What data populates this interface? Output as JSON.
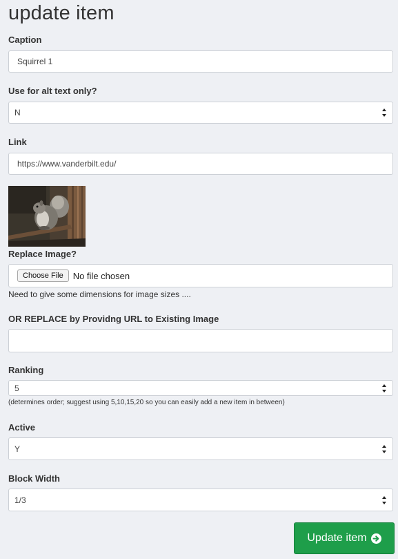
{
  "page": {
    "title": "update item"
  },
  "caption": {
    "label": "Caption",
    "value": "Squirrel 1"
  },
  "alt_text_only": {
    "label": "Use for alt text only?",
    "value": "N"
  },
  "link": {
    "label": "Link",
    "value": "https://www.vanderbilt.edu/"
  },
  "replace_image": {
    "label": "Replace Image?",
    "button": "Choose File",
    "status": "No file chosen",
    "note": "Need to give some dimensions for image sizes ...."
  },
  "replace_url": {
    "label": "OR REPLACE by Providng URL to Existing Image",
    "value": ""
  },
  "ranking": {
    "label": "Ranking",
    "value": "5",
    "hint": "(determines order; suggest using 5,10,15,20 so you can easily add a new item in between)"
  },
  "active": {
    "label": "Active",
    "value": "Y"
  },
  "block_width": {
    "label": "Block Width",
    "value": "1/3"
  },
  "submit": {
    "label": "Update item",
    "icon": "circle-arrow-right-icon"
  },
  "colors": {
    "background": "#eef0f4",
    "submit": "#1e9e4a"
  }
}
